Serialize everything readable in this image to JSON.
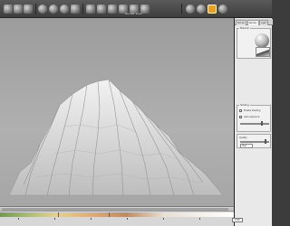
{
  "toolbar": {
    "caption": "Render view",
    "buttons": [
      "new-icon",
      "open-icon",
      "save-icon",
      "sphere-icon",
      "globe-icon",
      "shading-icon",
      "grid-icon",
      "camera-icon",
      "move-icon",
      "rotate-icon",
      "zoom-icon",
      "light-icon",
      "render-icon",
      "info-icon",
      "settings-icon",
      "help-icon"
    ]
  },
  "panel": {
    "tabs": [
      "Terrain",
      "Render",
      "Light"
    ],
    "material_group": "Material",
    "shading_group": "Shading",
    "shading_options": [
      "Enable shading",
      "Auto exposure"
    ],
    "quality_label": "Quality",
    "quality_value": "High"
  },
  "bottom": {
    "status_value": "0.00"
  },
  "colors": {
    "accent": "#e8a020",
    "viewport_bg": "#a8a8a8",
    "panel_bg": "#e9e9e9"
  }
}
